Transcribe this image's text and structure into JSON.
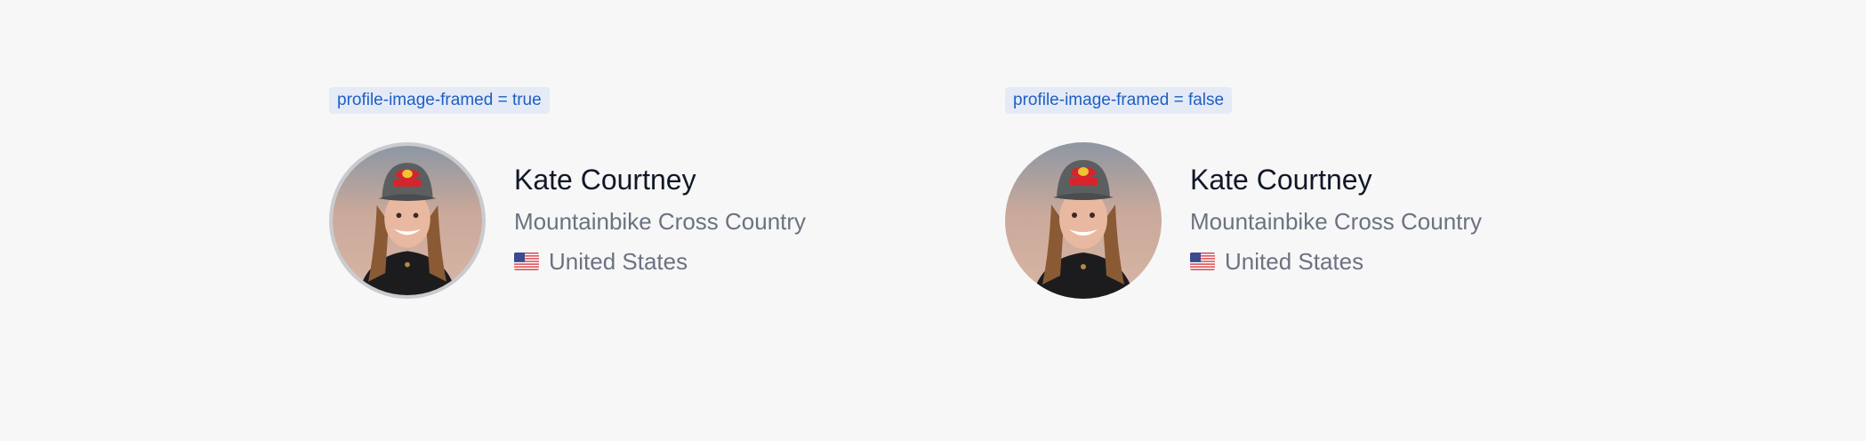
{
  "variants": [
    {
      "tag": "profile-image-framed = true",
      "framed": true,
      "profile": {
        "name": "Kate Courtney",
        "discipline": "Mountainbike Cross Country",
        "country": "United States",
        "flag_icon": "us-flag-icon"
      }
    },
    {
      "tag": "profile-image-framed = false",
      "framed": false,
      "profile": {
        "name": "Kate Courtney",
        "discipline": "Mountainbike Cross Country",
        "country": "United States",
        "flag_icon": "us-flag-icon"
      }
    }
  ],
  "colors": {
    "background": "#f7f7f8",
    "tag_background": "#e4eaf6",
    "tag_text": "#1f5fc2",
    "name_text": "#111827",
    "secondary_text": "#6b7280",
    "frame": "#c9cbcf"
  }
}
